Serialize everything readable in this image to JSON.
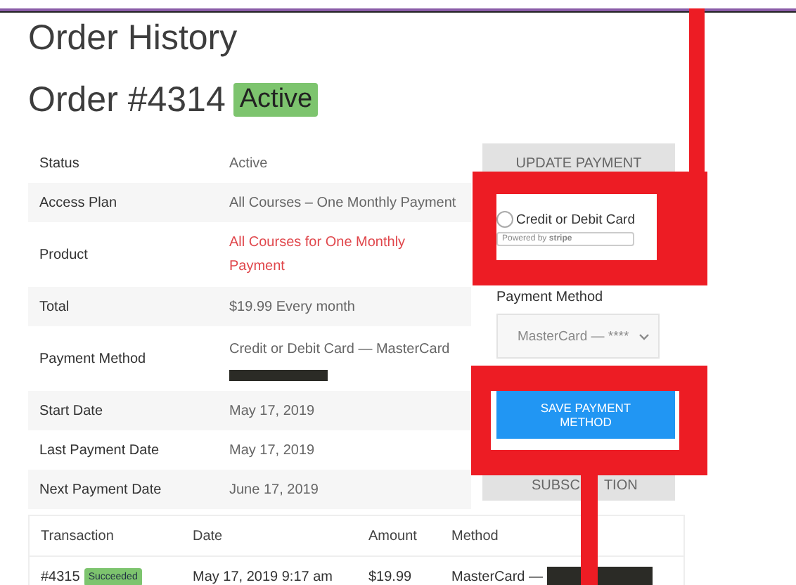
{
  "title": "Order History",
  "order": {
    "title": "Order #4314",
    "status_badge": "Active"
  },
  "details": [
    {
      "label": "Status",
      "value": "Active",
      "kind": "text",
      "redacted": false
    },
    {
      "label": "Access Plan",
      "value": "All Courses – One Monthly Payment",
      "kind": "text",
      "redacted": false
    },
    {
      "label": "Product",
      "value": "All Courses for One Monthly Payment",
      "kind": "link",
      "redacted": false
    },
    {
      "label": "Total",
      "value": "$19.99 Every month",
      "kind": "text",
      "redacted": false
    },
    {
      "label": "Payment Method",
      "value": "Credit or Debit Card — MasterCard",
      "kind": "text",
      "redacted": true
    },
    {
      "label": "Start Date",
      "value": "May 17, 2019",
      "kind": "text",
      "redacted": false
    },
    {
      "label": "Last Payment Date",
      "value": "May 17, 2019",
      "kind": "text",
      "redacted": false
    },
    {
      "label": "Next Payment Date",
      "value": "June 17, 2019",
      "kind": "text",
      "redacted": false
    }
  ],
  "payment": {
    "update_button": "UPDATE PAYMENT",
    "option": {
      "label": "Credit or Debit Card",
      "selected": false,
      "badge": "Powered by **stripe**"
    },
    "method_label": "Payment Method",
    "method_select": "MasterCard — ****",
    "save_button": "SAVE PAYMENT METHOD",
    "subscription_button": [
      "SUBSC",
      "TION"
    ]
  },
  "transactions": {
    "columns": [
      "Transaction",
      "Date",
      "Amount",
      "Method"
    ],
    "rows": [
      {
        "transaction": "#4315",
        "badge": "Succeeded",
        "date": "May 17, 2019 9:17 am",
        "amount": "$19.99",
        "method": "MasterCard —",
        "redacted": true
      }
    ]
  }
}
